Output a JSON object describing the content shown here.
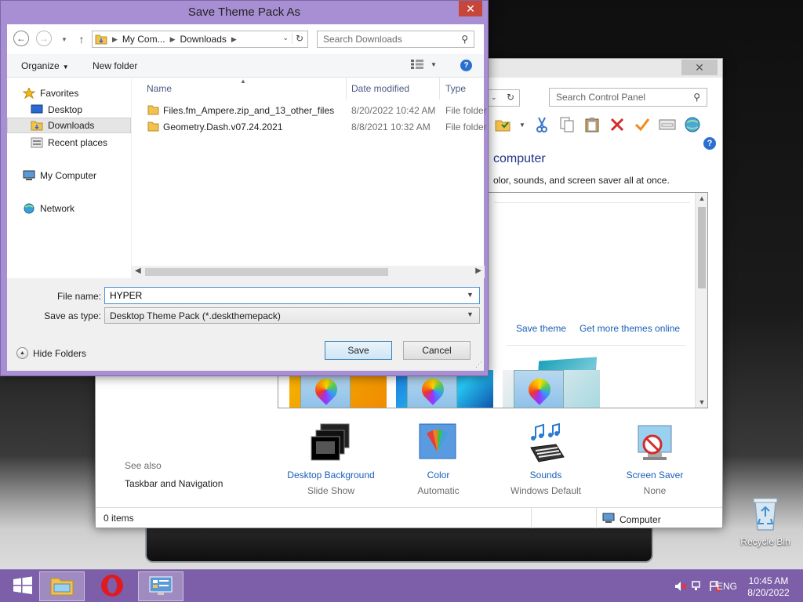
{
  "desktop": {
    "recycle_bin_label": "Recycle Bin"
  },
  "taskbar": {
    "items": [
      "start-button",
      "file-explorer",
      "opera",
      "control-panel"
    ],
    "language": "ENG",
    "time": "10:45 AM",
    "date": "8/20/2022",
    "accent_color": "#7c5fa8"
  },
  "control_panel": {
    "search_placeholder": "Search Control Panel",
    "heading": "computer",
    "description": "olor, sounds, and screen saver all at once.",
    "save_theme_link": "Save theme",
    "more_themes_link": "Get more themes online",
    "items": [
      {
        "label": "Desktop Background",
        "sub": "Slide Show"
      },
      {
        "label": "Color",
        "sub": "Automatic"
      },
      {
        "label": "Sounds",
        "sub": "Windows Default"
      },
      {
        "label": "Screen Saver",
        "sub": "None"
      }
    ],
    "see_also_label": "See also",
    "see_also_link": "Taskbar and Navigation",
    "status_items": "0 items",
    "status_location": "Computer"
  },
  "dialog": {
    "title": "Save Theme Pack As",
    "close_label": "✕",
    "breadcrumb": [
      "My Com...",
      "Downloads"
    ],
    "search_placeholder": "Search Downloads",
    "organize_label": "Organize",
    "new_folder_label": "New folder",
    "nav": {
      "favorites": "Favorites",
      "desktop": "Desktop",
      "downloads": "Downloads",
      "recent": "Recent places",
      "my_computer": "My Computer",
      "network": "Network"
    },
    "columns": {
      "name": "Name",
      "date": "Date modified",
      "type": "Type"
    },
    "files": [
      {
        "name": "Files.fm_Ampere.zip_and_13_other_files",
        "date": "8/20/2022 10:42 AM",
        "type": "File folder"
      },
      {
        "name": "Geometry.Dash.v07.24.2021",
        "date": "8/8/2021 10:32 AM",
        "type": "File folder"
      }
    ],
    "file_name_label": "File name:",
    "file_name_value": "HYPER",
    "save_type_label": "Save as type:",
    "save_type_value": "Desktop Theme Pack (*.deskthemepack)",
    "hide_folders_label": "Hide Folders",
    "save_label": "Save",
    "cancel_label": "Cancel",
    "title_color": "#a88ed2"
  }
}
